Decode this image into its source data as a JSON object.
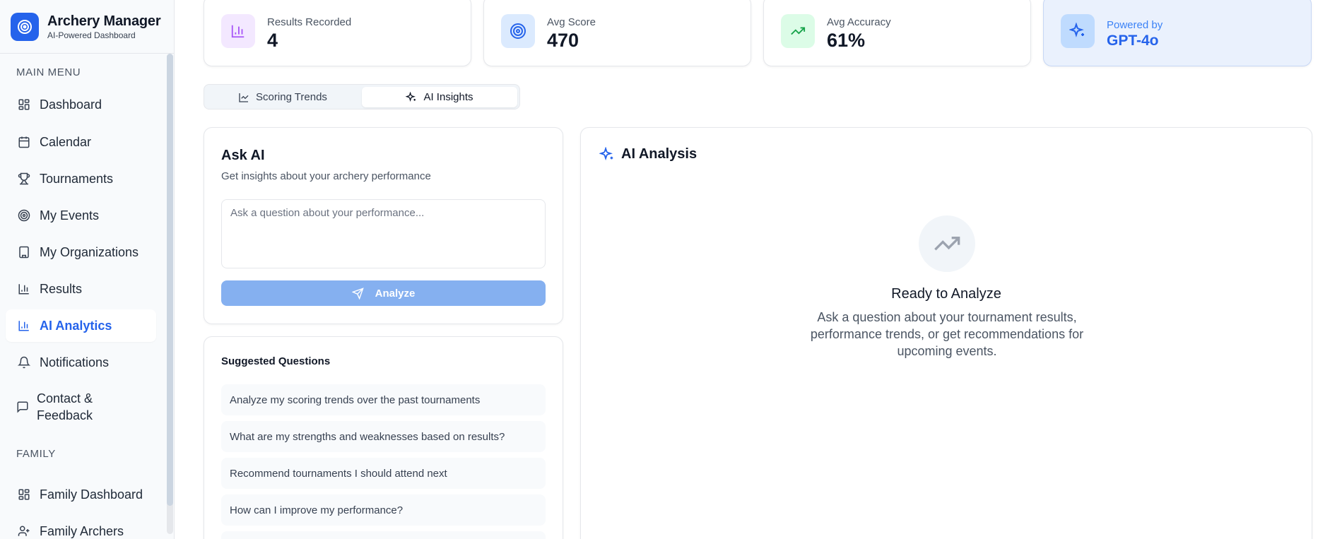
{
  "brand": {
    "title": "Archery Manager",
    "subtitle": "AI-Powered Dashboard"
  },
  "sidebar": {
    "main_menu_label": "MAIN MENU",
    "items": [
      {
        "label": "Dashboard",
        "icon": "dashboard-grid-icon"
      },
      {
        "label": "Calendar",
        "icon": "calendar-icon"
      },
      {
        "label": "Tournaments",
        "icon": "trophy-icon"
      },
      {
        "label": "My Events",
        "icon": "target-icon"
      },
      {
        "label": "My Organizations",
        "icon": "building-icon"
      },
      {
        "label": "Results",
        "icon": "bar-chart-icon"
      },
      {
        "label": "AI Analytics",
        "icon": "bar-chart-icon",
        "active": true
      },
      {
        "label": "Notifications",
        "icon": "bell-icon"
      },
      {
        "label": "Contact & Feedback",
        "icon": "message-icon"
      }
    ],
    "family_label": "FAMILY",
    "family_items": [
      {
        "label": "Family Dashboard",
        "icon": "dashboard-grid-icon"
      },
      {
        "label": "Family Archers",
        "icon": "user-plus-icon"
      }
    ]
  },
  "stats": [
    {
      "label": "Results Recorded",
      "value": "4",
      "icon": "bar-chart-icon",
      "color": "#a855f7"
    },
    {
      "label": "Avg Score",
      "value": "470",
      "icon": "target-icon",
      "color": "#2563eb"
    },
    {
      "label": "Avg Accuracy",
      "value": "61%",
      "icon": "trending-up-icon",
      "color": "#16a34a"
    },
    {
      "label": "Powered by",
      "value": "GPT-4o",
      "icon": "sparkles-icon",
      "color": "#2563eb"
    }
  ],
  "tabs": [
    {
      "label": "Scoring Trends",
      "icon": "line-chart-icon"
    },
    {
      "label": "AI Insights",
      "icon": "sparkles-icon",
      "active": true
    }
  ],
  "ask": {
    "title": "Ask AI",
    "description": "Get insights about your archery performance",
    "placeholder": "Ask a question about your performance...",
    "value": "",
    "button": "Analyze"
  },
  "suggestions": {
    "title": "Suggested Questions",
    "items": [
      "Analyze my scoring trends over the past tournaments",
      "What are my strengths and weaknesses based on results?",
      "Recommend tournaments I should attend next",
      "How can I improve my performance?"
    ]
  },
  "analysis": {
    "title": "AI Analysis",
    "empty_title": "Ready to Analyze",
    "empty_description": "Ask a question about your tournament results, performance trends, or get recommendations for upcoming events."
  },
  "colors": {
    "accent": "#2563eb",
    "button_disabled": "#85b0f0"
  }
}
